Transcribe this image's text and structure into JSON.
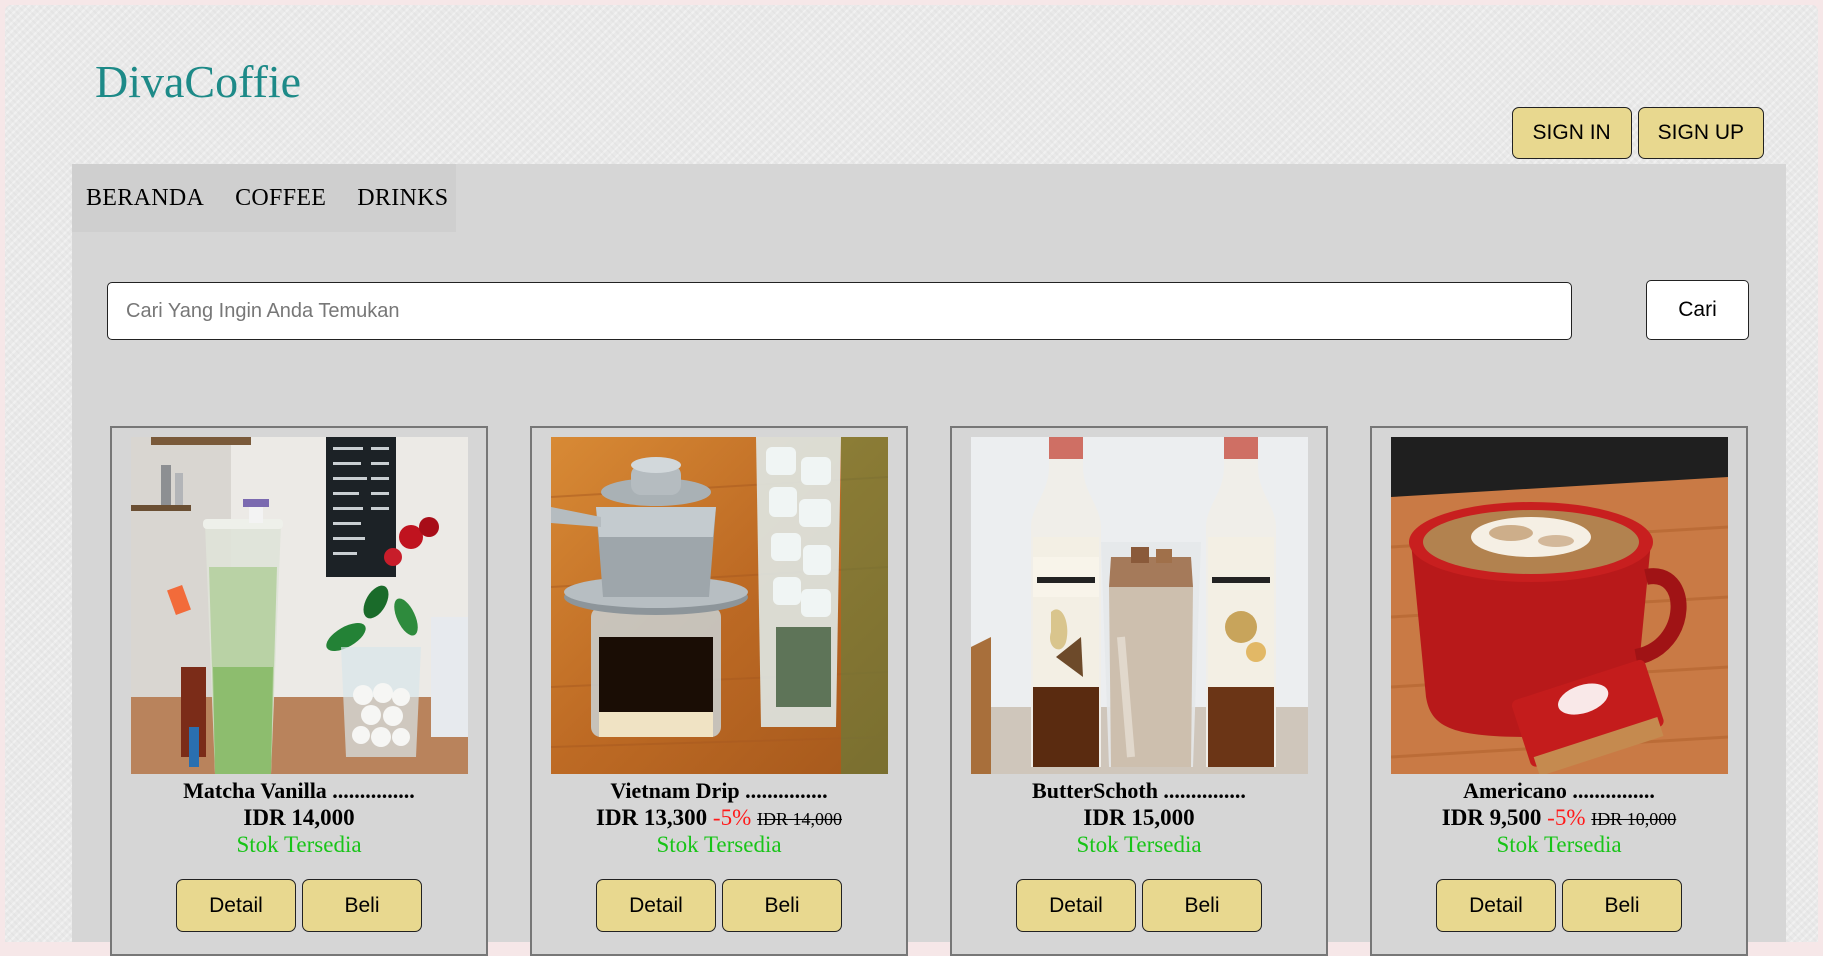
{
  "brand": {
    "name": "DivaCoffie"
  },
  "auth": {
    "sign_in": "SIGN IN",
    "sign_up": "SIGN UP"
  },
  "nav": {
    "items": [
      "BERANDA",
      "COFFEE",
      "DRINKS"
    ]
  },
  "search": {
    "placeholder": "Cari Yang Ingin Anda Temukan",
    "value": "",
    "button": "Cari"
  },
  "products": [
    {
      "name": "Matcha Vanilla ...............",
      "price": "IDR 14,000",
      "discount": "",
      "old_price": "",
      "stock": "Stok Tersedia",
      "image": "matcha-vanilla-photo",
      "detail": "Detail",
      "buy": "Beli"
    },
    {
      "name": "Vietnam Drip ...............",
      "price": "IDR 13,300",
      "discount": "-5%",
      "old_price": "IDR 14,000",
      "stock": "Stok Tersedia",
      "image": "vietnam-drip-photo",
      "detail": "Detail",
      "buy": "Beli"
    },
    {
      "name": "ButterSchoth ...............",
      "price": "IDR 15,000",
      "discount": "",
      "old_price": "",
      "stock": "Stok Tersedia",
      "image": "butterscotch-photo",
      "detail": "Detail",
      "buy": "Beli"
    },
    {
      "name": "Americano ...............",
      "price": "IDR 9,500",
      "discount": "-5%",
      "old_price": "IDR 10,000",
      "stock": "Stok Tersedia",
      "image": "americano-photo",
      "detail": "Detail",
      "buy": "Beli"
    }
  ],
  "colors": {
    "brand": "#1d8a88",
    "button": "#e8d88f",
    "discount": "#ff1a1a",
    "stock": "#18c418",
    "panel": "#d6d6d6"
  }
}
